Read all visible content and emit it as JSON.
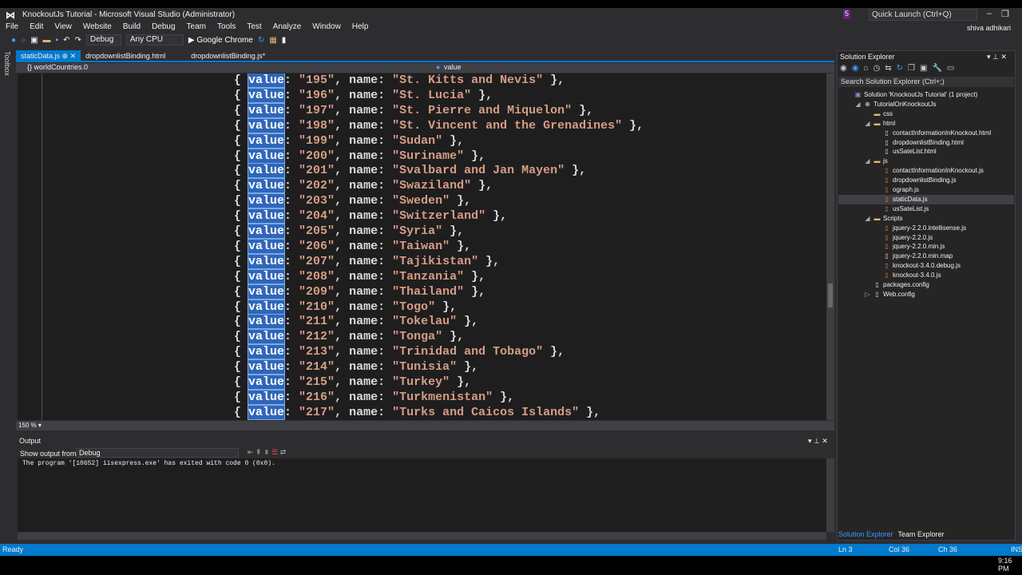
{
  "window": {
    "title": "KnockoutJs Tutorial - Microsoft Visual Studio (Administrator)",
    "quick_launch": "Quick Launch (Ctrl+Q)",
    "notifications": "5",
    "user": "shiva adhikari"
  },
  "menu": [
    "File",
    "Edit",
    "View",
    "Website",
    "Build",
    "Debug",
    "Team",
    "Tools",
    "Test",
    "Analyze",
    "Window",
    "Help"
  ],
  "toolbar": {
    "config": "Debug",
    "platform": "Any CPU",
    "run": "▶ Google Chrome"
  },
  "toolbox_label": "Toolbox",
  "tabs": [
    {
      "label": "staticData.js",
      "active": true
    },
    {
      "label": "dropdownlistBinding.html"
    },
    {
      "label": "dropdownlistBinding.js*"
    }
  ],
  "navbar": {
    "scope": "{} worldCountries.0",
    "member": "value"
  },
  "code": [
    [
      "195",
      "St. Kitts and Nevis"
    ],
    [
      "196",
      "St. Lucia"
    ],
    [
      "197",
      "St. Pierre and Miquelon"
    ],
    [
      "198",
      "St. Vincent and the Grenadines"
    ],
    [
      "199",
      "Sudan"
    ],
    [
      "200",
      "Suriname"
    ],
    [
      "201",
      "Svalbard and Jan Mayen"
    ],
    [
      "202",
      "Swaziland"
    ],
    [
      "203",
      "Sweden"
    ],
    [
      "204",
      "Switzerland"
    ],
    [
      "205",
      "Syria"
    ],
    [
      "206",
      "Taiwan"
    ],
    [
      "207",
      "Tajikistan"
    ],
    [
      "208",
      "Tanzania"
    ],
    [
      "209",
      "Thailand"
    ],
    [
      "210",
      "Togo"
    ],
    [
      "211",
      "Tokelau"
    ],
    [
      "212",
      "Tonga"
    ],
    [
      "213",
      "Trinidad and Tobago"
    ],
    [
      "214",
      "Tunisia"
    ],
    [
      "215",
      "Turkey"
    ],
    [
      "216",
      "Turkmenistan"
    ],
    [
      "217",
      "Turks and Caicos Islands"
    ]
  ],
  "zoom": "150 %",
  "output": {
    "title": "Output",
    "from_label": "Show output from:",
    "from_value": "Debug",
    "text": "The program '[10652] iisexpress.exe' has exited with code 0 (0x0)."
  },
  "solution_explorer": {
    "title": "Solution Explorer",
    "search_placeholder": "Search Solution Explorer (Ctrl+;)",
    "items": [
      {
        "label": "Solution 'KnockoutJs Tutorial' (1 project)",
        "level": 0,
        "icon": "solution-icon"
      },
      {
        "label": "TutorialOnKnockoutJs",
        "level": 1,
        "icon": "globe-icon",
        "arrow": "◢"
      },
      {
        "label": "css",
        "level": 2,
        "icon": "folder-icon"
      },
      {
        "label": "html",
        "level": 2,
        "icon": "folder-icon",
        "arrow": "◢"
      },
      {
        "label": "contactInformationInKnockout.html",
        "level": 3,
        "icon": "file-icon"
      },
      {
        "label": "dropdownlistBinding.html",
        "level": 3,
        "icon": "file-icon"
      },
      {
        "label": "usSateList.html",
        "level": 3,
        "icon": "file-icon"
      },
      {
        "label": "js",
        "level": 2,
        "icon": "folder-icon",
        "arrow": "◢"
      },
      {
        "label": "contactInformationInKnockout.js",
        "level": 3,
        "icon": "js-file-icon"
      },
      {
        "label": "dropdownlistBinding.js",
        "level": 3,
        "icon": "js-file-icon"
      },
      {
        "label": "ograph.js",
        "level": 3,
        "icon": "js-file-icon"
      },
      {
        "label": "staticData.js",
        "level": 3,
        "icon": "js-file-icon",
        "selected": true
      },
      {
        "label": "usSateList.js",
        "level": 3,
        "icon": "js-file-icon"
      },
      {
        "label": "Scripts",
        "level": 2,
        "icon": "folder-icon",
        "arrow": "◢"
      },
      {
        "label": "jquery-2.2.0.intellisense.js",
        "level": 3,
        "icon": "js-file-icon"
      },
      {
        "label": "jquery-2.2.0.js",
        "level": 3,
        "icon": "js-file-icon"
      },
      {
        "label": "jquery-2.2.0.min.js",
        "level": 3,
        "icon": "js-file-icon"
      },
      {
        "label": "jquery-2.2.0.min.map",
        "level": 3,
        "icon": "file-icon"
      },
      {
        "label": "knockout-3.4.0.debug.js",
        "level": 3,
        "icon": "js-file-icon"
      },
      {
        "label": "knockout-3.4.0.js",
        "level": 3,
        "icon": "js-file-icon"
      },
      {
        "label": "packages.config",
        "level": 2,
        "icon": "config-icon"
      },
      {
        "label": "Web.config",
        "level": 2,
        "icon": "config-icon",
        "arrow": "▷"
      }
    ],
    "tabs": [
      "Solution Explorer",
      "Team Explorer"
    ]
  },
  "status": {
    "state": "Ready",
    "ln": "Ln 3",
    "col": "Col 36",
    "ch": "Ch 36",
    "mode": "INS"
  },
  "clock": "9:16 PM",
  "colors": {
    "accent": "#007acc",
    "string": "#d69d85",
    "highlight": "#2f66b8"
  }
}
